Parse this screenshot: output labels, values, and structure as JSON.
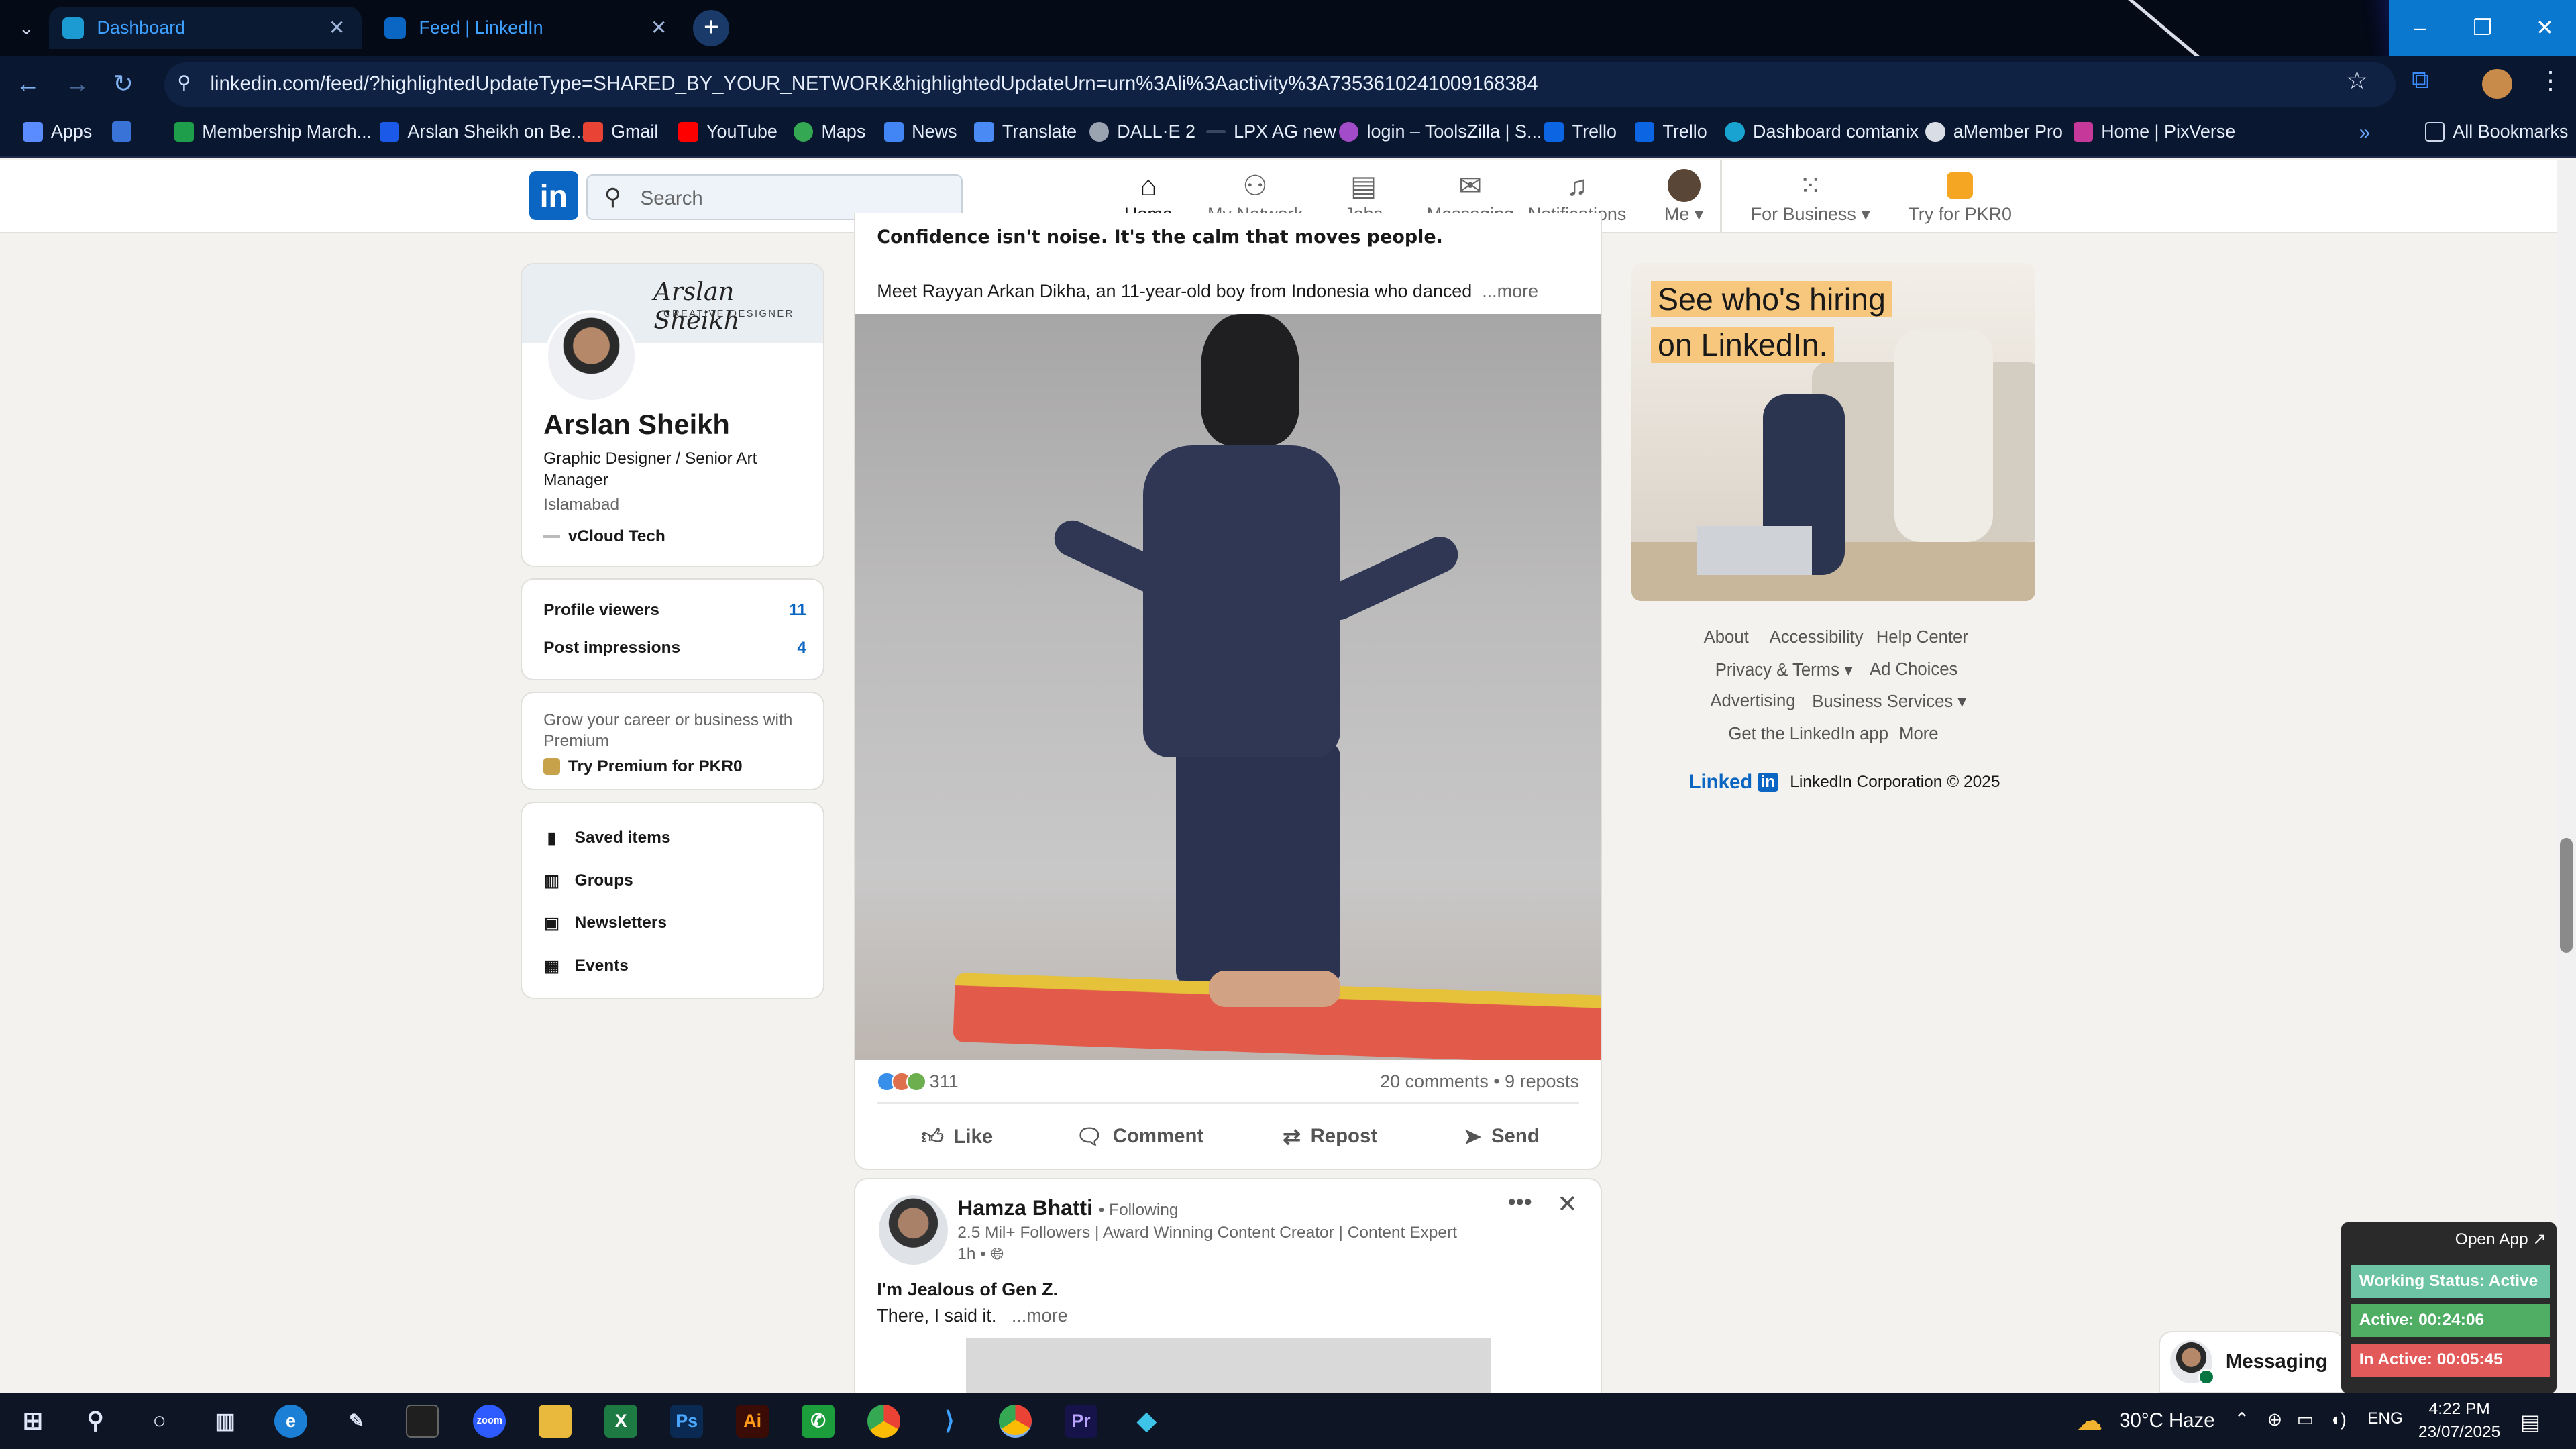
{
  "browser": {
    "tabs": [
      {
        "title": "Dashboard"
      },
      {
        "title": "Feed | LinkedIn"
      }
    ],
    "url": "linkedin.com/feed/?highlightedUpdateType=SHARED_BY_YOUR_NETWORK&highlightedUpdateUrn=urn%3Ali%3Aactivity%3A7353610241009168384",
    "bookmarks": [
      "Apps",
      "Membership March...",
      "Arslan Sheikh on Be...",
      "Gmail",
      "YouTube",
      "Maps",
      "News",
      "Translate",
      "DALL·E 2",
      "LPX AG new",
      "login – ToolsZilla | S...",
      "Trello",
      "Trello",
      "Dashboard comtanix",
      "aMember Pro",
      "Home | PixVerse"
    ],
    "all_bookmarks": "All Bookmarks"
  },
  "linkedin": {
    "logo": "in",
    "search_placeholder": "Search",
    "nav": [
      {
        "label": "Home",
        "icon": "home-icon"
      },
      {
        "label": "My Network",
        "icon": "network-icon"
      },
      {
        "label": "Jobs",
        "icon": "briefcase-icon"
      },
      {
        "label": "Messaging",
        "icon": "chat-icon"
      },
      {
        "label": "Notifications",
        "icon": "bell-icon"
      },
      {
        "label": "Me",
        "icon": "avatar"
      },
      {
        "label": "For Business",
        "icon": "grid-icon"
      },
      {
        "label": "Try for PKR0",
        "icon": "premium-icon"
      }
    ]
  },
  "profile": {
    "cover_signature": "Arslan Sheikh",
    "cover_subtitle": "CREATIVE DESIGNER",
    "name": "Arslan Sheikh",
    "headline": "Graphic Designer / Senior Art Manager",
    "location": "Islamabad",
    "company": "vCloud Tech",
    "stats": [
      {
        "label": "Profile viewers",
        "value": "11"
      },
      {
        "label": "Post impressions",
        "value": "4"
      }
    ],
    "premium_text": "Grow your career or business with Premium",
    "premium_link": "Try Premium for PKR0",
    "links": [
      "Saved items",
      "Groups",
      "Newsletters",
      "Events"
    ]
  },
  "post1": {
    "hook": "Confidence isn't noise. It's the calm that moves people.",
    "body": "Meet Rayyan Arkan Dikha, an 11-year-old boy from Indonesia who danced",
    "more": "...more",
    "reactions": "311",
    "counts": "20 comments • 9 reposts",
    "actions": [
      "Like",
      "Comment",
      "Repost",
      "Send"
    ]
  },
  "post2": {
    "author": "Hamza Bhatti",
    "follow": "• Following",
    "subtitle": "2.5 Mil+ Followers | Award Winning Content Creator | Content Expert",
    "time": "1h •",
    "line1": "I'm Jealous of Gen Z.",
    "line2": "There, I said it.",
    "more": "...more"
  },
  "ad": {
    "line1": "See who's hiring",
    "line2": "on LinkedIn."
  },
  "footer": {
    "row1": [
      "About",
      "Accessibility",
      "Help Center"
    ],
    "row2": [
      "Privacy & Terms ▾",
      "Ad Choices"
    ],
    "row3": [
      "Advertising",
      "Business Services ▾"
    ],
    "row4": [
      "Get the LinkedIn app",
      "More"
    ],
    "brand": "Linked",
    "brand_in": "in",
    "copyright": "LinkedIn Corporation © 2025"
  },
  "messaging": {
    "label": "Messaging"
  },
  "tracker": {
    "open_app": "Open App ↗",
    "status": "Working Status: Active",
    "active": "Active: 00:24:06",
    "inactive": "In Active: 00:05:45"
  },
  "taskbar": {
    "weather": "30°C Haze",
    "lang": "ENG",
    "time": "4:22 PM",
    "date": "23/07/2025"
  },
  "colors": {
    "linkedin_blue": "#0a66c2",
    "premium_gold": "#f8c77e",
    "active_green": "#4fae64",
    "inactive_red": "#e35a5a"
  }
}
